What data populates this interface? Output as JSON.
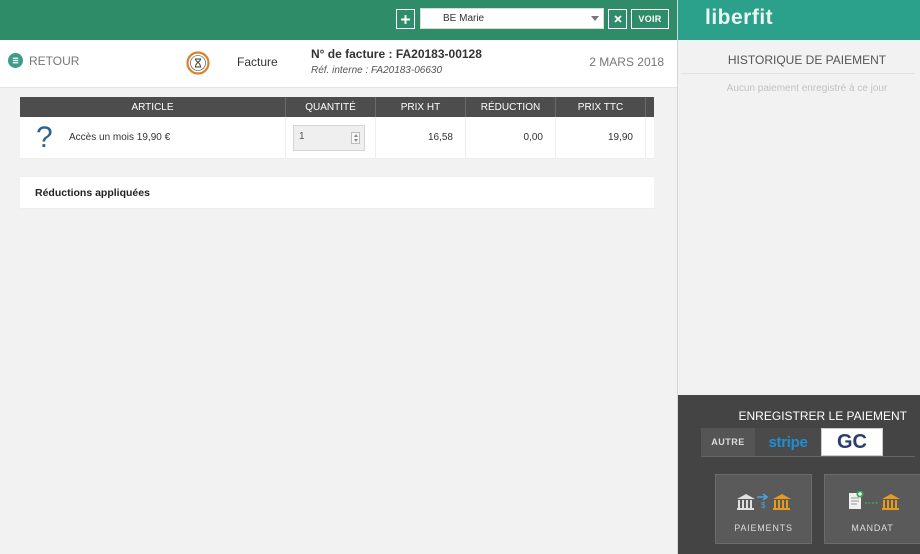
{
  "topbar": {
    "add_icon": "plus-icon",
    "client_value": "BE Marie",
    "clear_icon": "close-icon",
    "voir_label": "VOIR"
  },
  "header": {
    "back_label": "RETOUR",
    "back_icon": "list-icon",
    "status_icon": "hourglass-icon",
    "doc_type": "Facture",
    "invoice_number": "N° de facture : FA20183-00128",
    "internal_ref": "Réf. interne : FA20183-06630",
    "date": "2 MARS 2018"
  },
  "table": {
    "columns": [
      "ARTICLE",
      "QUANTITÉ",
      "PRIX HT",
      "RÉDUCTION",
      "PRIX TTC"
    ],
    "rows": [
      {
        "icon": "question-mark-icon",
        "article": "Accès un mois 19,90 €",
        "quantity": "1",
        "prix_ht": "16,58",
        "reduction": "0,00",
        "prix_ttc": "19,90"
      }
    ]
  },
  "reductions": {
    "title": "Réductions appliquées"
  },
  "right_panel": {
    "logo": "liberfit",
    "history_title": "HISTORIQUE DE PAIEMENT",
    "history_empty": "Aucun paiement enregistré à ce jour",
    "register_title": "ENREGISTRER LE PAIEMENT",
    "tabs": [
      "AUTRE",
      "stripe",
      "GC"
    ],
    "active_tab": "GC",
    "buttons": [
      {
        "label": "PAIEMENTS",
        "icon": "bank-transfer-icon"
      },
      {
        "label": "MANDAT",
        "icon": "mandate-icon"
      }
    ]
  },
  "colors": {
    "topbar_green": "#2e8c68",
    "logo_bar_teal": "#2ba08a",
    "table_header": "#4d4d4d",
    "pay_panel": "#444444",
    "stripe_blue": "#1e8fd6",
    "bank_orange": "#e89a1c"
  }
}
